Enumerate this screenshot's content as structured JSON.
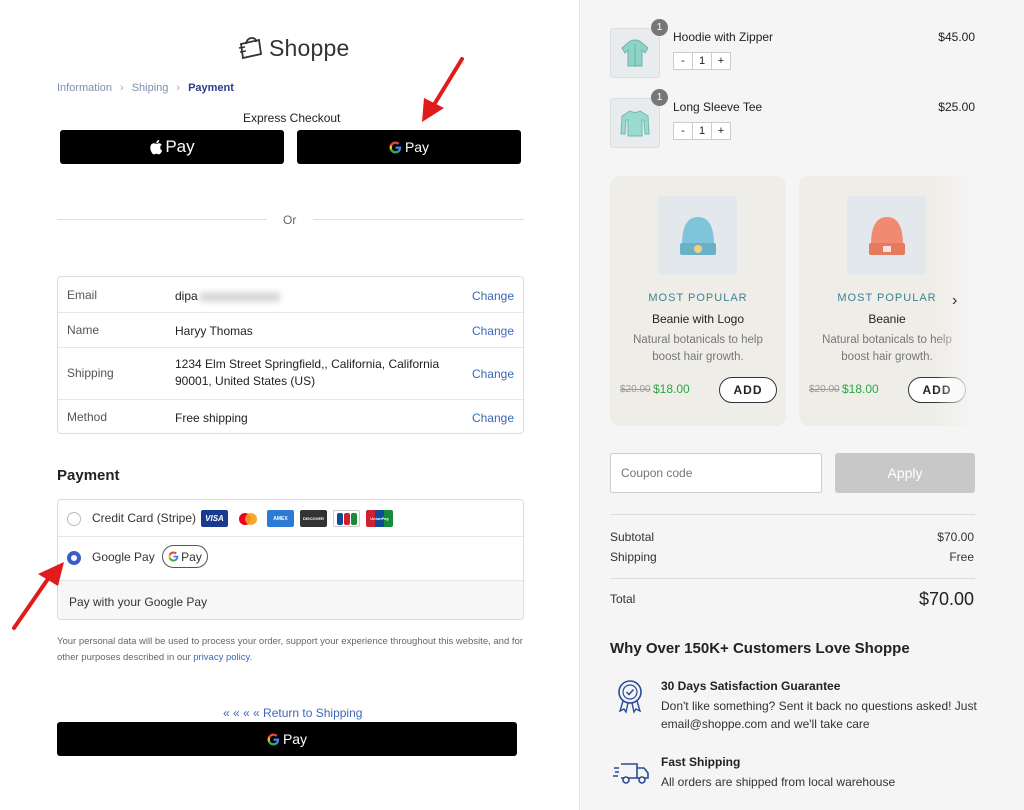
{
  "brand": {
    "name": "Shoppe"
  },
  "breadcrumb": {
    "information": "Information",
    "shipping": "Shiping",
    "payment": "Payment"
  },
  "express": {
    "title": "Express Checkout",
    "apple_pay_label": "Pay",
    "google_pay_label": "Pay"
  },
  "divider_or": "Or",
  "info": {
    "change_label": "Change",
    "rows": [
      {
        "key": "Email",
        "value": "dipa"
      },
      {
        "key": "Name",
        "value": "Haryy Thomas"
      },
      {
        "key": "Shipping",
        "value": "1234 Elm Street Springfield,, California, California 90001, United States (US)"
      },
      {
        "key": "Method",
        "value": "Free shipping"
      }
    ]
  },
  "payment": {
    "heading": "Payment",
    "methods": [
      {
        "label": "Credit Card (Stripe)",
        "selected": false
      },
      {
        "label": "Google Pay",
        "selected": true
      }
    ],
    "card_brands": [
      "VISA",
      "MC",
      "AMEX",
      "DISCOVER",
      "JCB",
      "UnionPay"
    ],
    "gpay_pill": "Pay",
    "gpay_desc": "Pay with your Google Pay"
  },
  "privacy": {
    "text": "Your personal data will be used to process your order, support your experience throughout this website, and for other purposes described in our ",
    "link": "privacy policy",
    "end": "."
  },
  "return_link": "« « « « Return to Shipping",
  "bottom_gpay_label": "Pay",
  "cart": {
    "items": [
      {
        "name": "Hoodie with Zipper",
        "price": "$45.00",
        "qty": "1",
        "badge": "1"
      },
      {
        "name": "Long Sleeve Tee",
        "price": "$25.00",
        "qty": "1",
        "badge": "1"
      }
    ],
    "minus": "-",
    "plus": "+"
  },
  "upsell": [
    {
      "tag": "MOST POPULAR",
      "name": "Beanie with Logo",
      "desc": "Natural botanicals to help boost hair growth.",
      "old_price": "$20.00",
      "new_price": "$18.00",
      "add": "ADD",
      "color": "#7fc4d8"
    },
    {
      "tag": "MOST POPULAR",
      "name": "Beanie",
      "desc": "Natural botanicals to help boost hair growth.",
      "old_price": "$20.00",
      "new_price": "$18.00",
      "add": "ADD",
      "color": "#f08a70"
    }
  ],
  "coupon": {
    "placeholder": "Coupon code",
    "apply": "Apply"
  },
  "totals": {
    "subtotal_label": "Subtotal",
    "subtotal": "$70.00",
    "shipping_label": "Shipping",
    "shipping": "Free",
    "total_label": "Total",
    "total": "$70.00"
  },
  "why": {
    "title": "Why Over 150K+ Customers Love Shoppe",
    "features": [
      {
        "title": "30 Days Satisfaction Guarantee",
        "desc": "Don't like something? Sent it back no questions asked! Just email@shoppe.com and we'll take care"
      },
      {
        "title": "Fast Shipping",
        "desc": "All orders are shipped from local warehouse"
      }
    ]
  },
  "colors": {
    "accent": "#3b5ccc",
    "link": "#3e68b8",
    "arrow": "#e01b1b",
    "sale": "#2aa844"
  }
}
